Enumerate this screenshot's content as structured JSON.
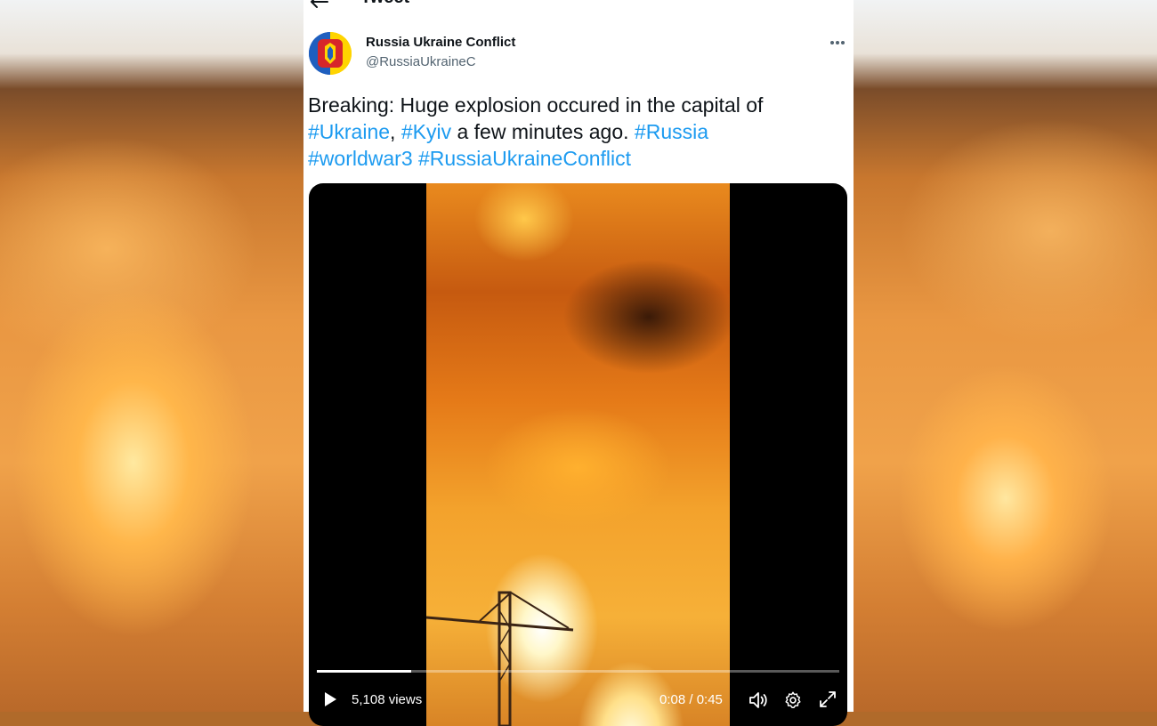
{
  "header": {
    "title": "Tweet",
    "back_icon": "arrow-left-icon"
  },
  "author": {
    "name": "Russia Ukraine Conflict",
    "handle": "@RussiaUkraineC",
    "avatar_icon": "flag-coat-of-arms-avatar"
  },
  "tweet": {
    "text_1": "Breaking: Huge explosion occured in the capital of",
    "tag_ukraine": "#Ukraine",
    "sep_1": ",",
    "tag_kyiv": "#Kyiv",
    "text_2": "a few minutes ago.",
    "tag_russia": "#Russia",
    "tag_worldwar3": "#worldwar3",
    "tag_conflict": "#RussiaUkraineConflict"
  },
  "video": {
    "views": "5,108 views",
    "time": "0:08 / 0:45",
    "progress": 0.18
  },
  "colors": {
    "link": "#1d9bf0",
    "text": "#0f1419",
    "muted": "#536471"
  }
}
